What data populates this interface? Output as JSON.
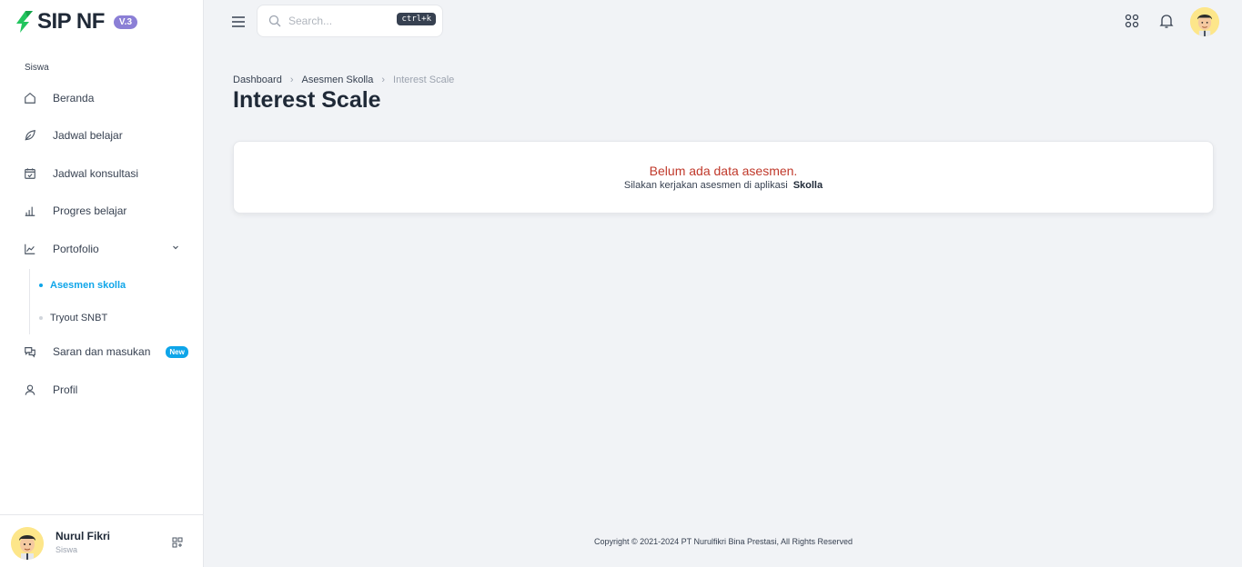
{
  "brand": {
    "name": "SIP NF",
    "version": "V.3"
  },
  "sidebar": {
    "section_label": "Siswa",
    "items": [
      {
        "label": "Beranda",
        "icon": "home-icon"
      },
      {
        "label": "Jadwal belajar",
        "icon": "leaf-icon"
      },
      {
        "label": "Jadwal konsultasi",
        "icon": "calendar-check-icon"
      },
      {
        "label": "Progres belajar",
        "icon": "bar-chart-icon"
      },
      {
        "label": "Portofolio",
        "icon": "line-chart-icon"
      },
      {
        "label": "Saran dan masukan",
        "icon": "chat-icon",
        "badge": "New"
      },
      {
        "label": "Profil",
        "icon": "user-icon"
      }
    ],
    "portofolio_sub": [
      {
        "label": "Asesmen skolla",
        "active": true
      },
      {
        "label": "Tryout SNBT",
        "active": false
      }
    ],
    "user": {
      "name": "Nurul Fikri",
      "role": "Siswa"
    }
  },
  "topbar": {
    "search_placeholder": "Search...",
    "search_shortcut": "ctrl+k"
  },
  "breadcrumb": [
    "Dashboard",
    "Asesmen Skolla",
    "Interest Scale"
  ],
  "page_title": "Interest Scale",
  "empty_state": {
    "title": "Belum ada data asesmen.",
    "description": "Silakan kerjakan asesmen di aplikasi",
    "app_name": "Skolla"
  },
  "footer": "Copyright © 2021-2024 PT Nurulfikri Bina Prestasi, All Rights Reserved",
  "colors": {
    "accent": "#0ea5e9",
    "version_badge": "#8b7fd6",
    "empty_title": "#c0392b",
    "logo_green": "#22c55e"
  }
}
